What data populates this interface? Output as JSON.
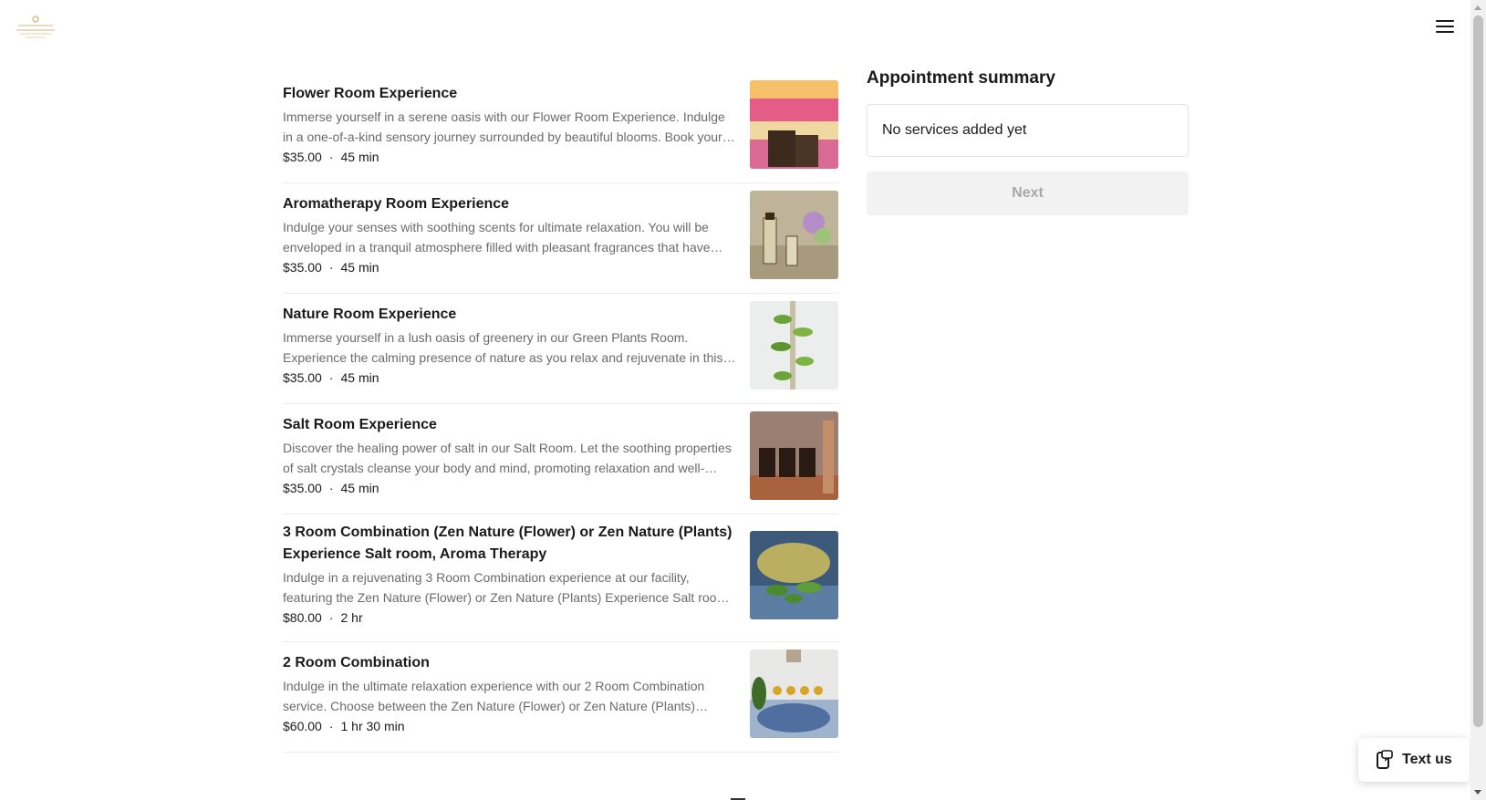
{
  "header": {
    "logo_icon": "business-logo-icon",
    "menu_icon": "hamburger-menu-icon"
  },
  "services": [
    {
      "name": "Flower Room Experience",
      "description": "Immerse yourself in a serene oasis with our Flower Room Experience. Indulge in a one-of-a-kind sensory journey surrounded by beautiful blooms. Book your session today.",
      "price": "$35.00",
      "duration": "45 min"
    },
    {
      "name": "Aromatherapy Room Experience",
      "description": "Indulge your senses with soothing scents for ultimate relaxation. You will be enveloped in a tranquil atmosphere filled with pleasant fragrances that have calming effects.",
      "price": "$35.00",
      "duration": "45 min"
    },
    {
      "name": "Nature Room Experience",
      "description": "Immerse yourself in a lush oasis of greenery in our Green Plants Room. Experience the calming presence of nature as you relax and rejuvenate in this peaceful space.",
      "price": "$35.00",
      "duration": "45 min"
    },
    {
      "name": "Salt Room Experience",
      "description": "Discover the healing power of salt in our Salt Room. Let the soothing properties of salt crystals cleanse your body and mind, promoting relaxation and well-being.",
      "price": "$35.00",
      "duration": "45 min"
    },
    {
      "name": "3 Room Combination (Zen Nature (Flower) or Zen Nature (Plants) Experience Salt room, Aroma Therapy",
      "description": "Indulge in a rejuvenating 3 Room Combination experience at our facility, featuring the Zen Nature (Flower) or Zen Nature (Plants) Experience Salt room, and Aroma Therapy.",
      "price": "$80.00",
      "duration": "2 hr"
    },
    {
      "name": "2 Room Combination",
      "description": "Indulge in the ultimate relaxation experience with our 2 Room Combination service. Choose between the Zen Nature (Flower) or Zen Nature (Plants) experience and more.",
      "price": "$60.00",
      "duration": "1 hr 30 min"
    }
  ],
  "summary": {
    "title": "Appointment summary",
    "empty_text": "No services added yet",
    "next_label": "Next"
  },
  "text_us": {
    "label": "Text us",
    "icon": "phone-message-icon"
  },
  "colors": {
    "text": "#1a1a1a",
    "muted": "#6b6b6b",
    "border": "#ececec",
    "disabled_bg": "#f2f2f2",
    "disabled_text": "#a8a8a8"
  }
}
